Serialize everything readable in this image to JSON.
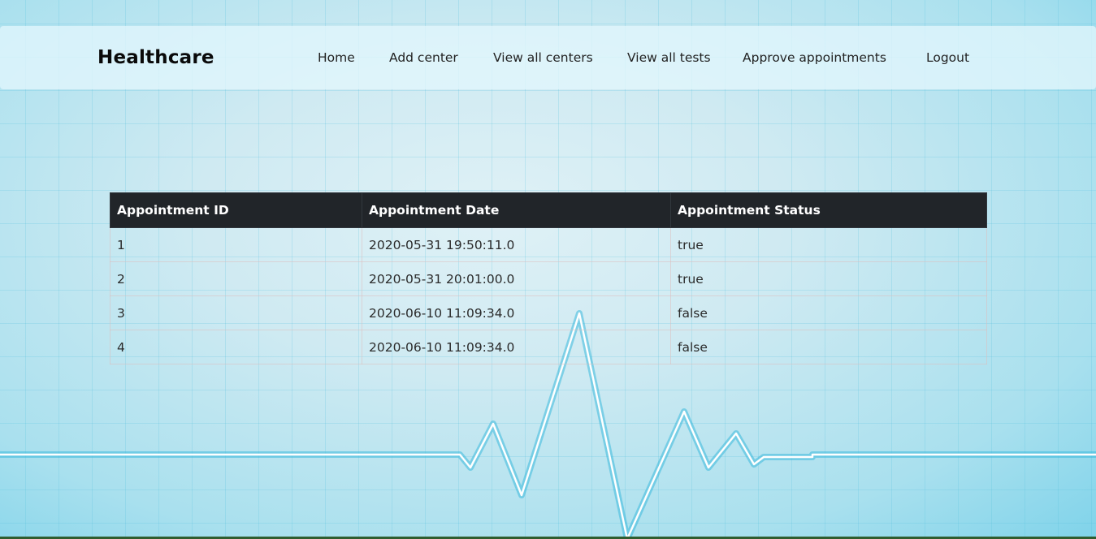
{
  "brand": "Healthcare",
  "nav": {
    "items": [
      "Home",
      "Add center",
      "View all centers",
      "View all tests",
      "Approve appointments",
      "Logout"
    ]
  },
  "table": {
    "headers": [
      "Appointment ID",
      "Appointment Date",
      "Appointment Status"
    ],
    "rows": [
      [
        "1",
        "2020-05-31 19:50:11.0",
        "true"
      ],
      [
        "2",
        "2020-05-31 20:01:00.0",
        "true"
      ],
      [
        "3",
        "2020-06-10 11:09:34.0",
        "false"
      ],
      [
        "4",
        "2020-06-10 11:09:34.0",
        "false"
      ]
    ]
  },
  "colors": {
    "table_header_bg": "#212529",
    "background_accent": "#7fd3ea"
  }
}
